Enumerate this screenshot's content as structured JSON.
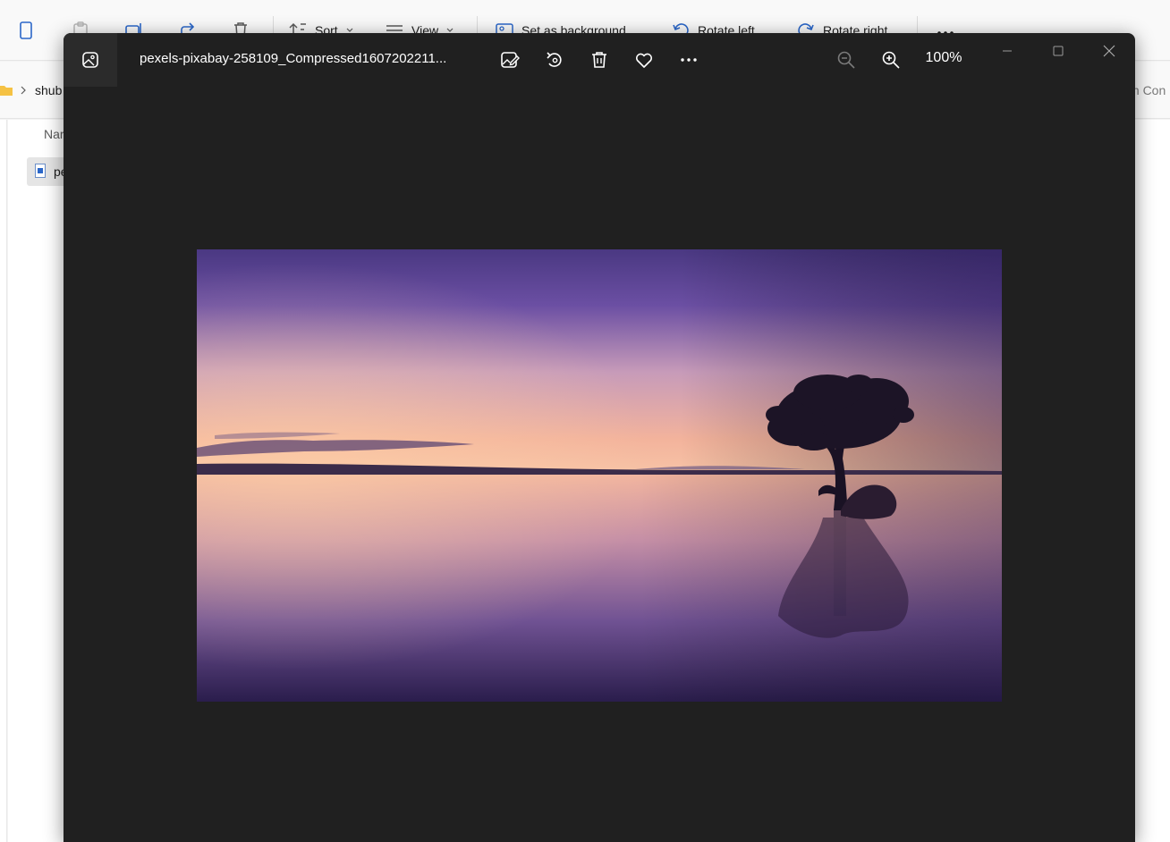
{
  "explorer": {
    "toolbar": {
      "sort_label": "Sort",
      "view_label": "View",
      "set_background_label": "Set as background",
      "rotate_left_label": "Rotate left",
      "rotate_right_label": "Rotate right"
    },
    "address": {
      "folder_label": "shub",
      "right_text": "th Con"
    },
    "list": {
      "column_name": "Nar",
      "file_label": "pe"
    }
  },
  "viewer": {
    "title": "pexels-pixabay-258109_Compressed1607202211...",
    "zoom_level": "100%",
    "toolbar_icons": [
      "edit-image-icon",
      "rotate-icon",
      "delete-icon",
      "favorite-heart-icon",
      "more-options-icon",
      "zoom-out-icon",
      "zoom-in-icon"
    ],
    "window_controls": [
      "minimize-icon",
      "maximize-icon",
      "close-icon"
    ],
    "colors": {
      "background": "#202020",
      "titlebar_icon_box": "#2b2b2b",
      "icon": "#ffffff",
      "icon_disabled": "#7a7a7a"
    }
  },
  "photo": {
    "description_colors": {
      "sky_top": "#4a3882",
      "horizon": "#f7b79a",
      "water_bottom": "#2a1d4c"
    }
  }
}
